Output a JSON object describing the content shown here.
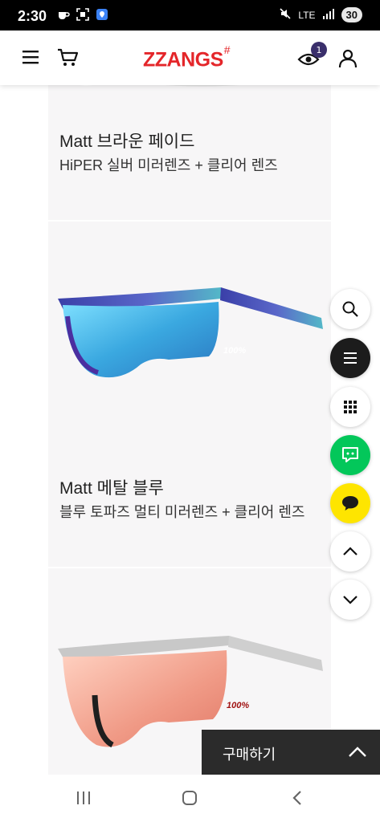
{
  "status_bar": {
    "time": "2:30",
    "network": "LTE",
    "battery": "30"
  },
  "header": {
    "logo_text": "ZZANGS",
    "logo_mark": "#",
    "view_count": "1",
    "brand_color": "#e4262a"
  },
  "products": [
    {
      "title": "Matt 브라운 페이드",
      "subtitle": "HiPER 실버 미러렌즈 + 클리어 렌즈"
    },
    {
      "title": "Matt 메탈 블루",
      "subtitle": "블루 토파즈 멀티 미러렌즈 + 클리어 렌즈",
      "logo_text": "100%"
    },
    {
      "logo_text": "100%"
    }
  ],
  "side_buttons": [
    {
      "icon": "search-icon"
    },
    {
      "icon": "menu-icon"
    },
    {
      "icon": "grid-icon"
    },
    {
      "icon": "talk-icon"
    },
    {
      "icon": "chat-bubble-icon"
    },
    {
      "icon": "chevron-up-icon"
    },
    {
      "icon": "chevron-down-icon"
    }
  ],
  "buy_bar": {
    "label": "구매하기"
  },
  "navigation": {
    "recent": "recent-apps-icon",
    "home": "home-icon",
    "back": "back-icon"
  }
}
